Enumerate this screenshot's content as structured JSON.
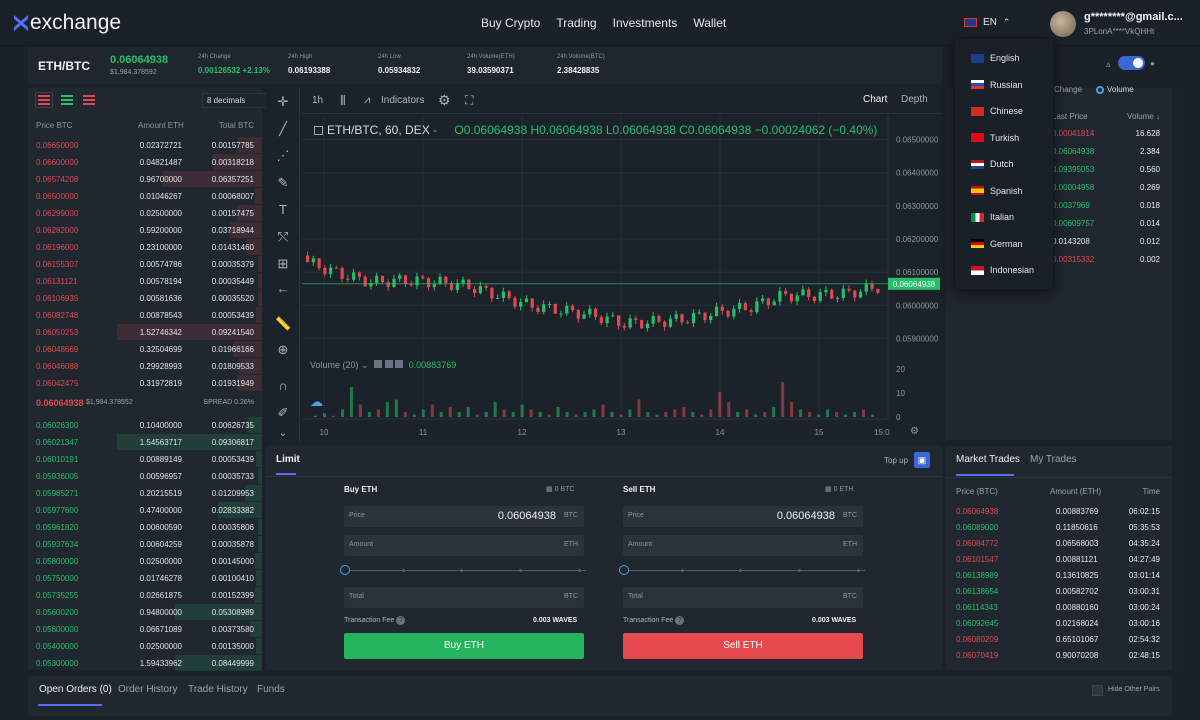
{
  "brand": {
    "name": "exchange"
  },
  "nav": [
    "Buy Crypto",
    "Trading",
    "Investments",
    "Wallet"
  ],
  "language": {
    "current": "EN",
    "options": [
      "English",
      "Russian",
      "Chinese",
      "Turkish",
      "Dutch",
      "Spanish",
      "Italian",
      "German",
      "Indonesian"
    ]
  },
  "account": {
    "email": "g********@gmail.c...",
    "id": "3PLonA****VkQHHt"
  },
  "ticker": {
    "pair": "ETH/BTC",
    "price": "0.06064938",
    "price_usd": "$1,984.378592",
    "stats": [
      {
        "label": "24h Change",
        "value": "0.00126532",
        "extra": "+2.13%"
      },
      {
        "label": "24h High",
        "value": "0.06193388"
      },
      {
        "label": "24h Low",
        "value": "0.05934832"
      },
      {
        "label": "24h Volume(ETH)",
        "value": "39.03590371"
      },
      {
        "label": "24h Volume(BTC)",
        "value": "2.38428835"
      }
    ]
  },
  "orderbook": {
    "decimals": "8 decimals",
    "headers": [
      "Price BTC",
      "Amount ETH",
      "Total BTC"
    ],
    "asks": [
      [
        "0.06650000",
        "0.02372721",
        "0.00157785",
        0.17
      ],
      [
        "0.06600000",
        "0.04821487",
        "0.00318218",
        0.34
      ],
      [
        "0.06574208",
        "0.96700000",
        "0.06357251",
        0.68
      ],
      [
        "0.06500000",
        "0.01046267",
        "0.00068007",
        0.05
      ],
      [
        "0.06299000",
        "0.02500000",
        "0.00157475",
        0.17
      ],
      [
        "0.06282000",
        "0.59200000",
        "0.03718944",
        0.22
      ],
      [
        "0.06196000",
        "0.23100000",
        "0.01431460",
        0.1
      ],
      [
        "0.06155307",
        "0.00574786",
        "0.00035379",
        0.03
      ],
      [
        "0.06131121",
        "0.00578194",
        "0.00035449",
        0.03
      ],
      [
        "0.06106935",
        "0.00581636",
        "0.00035520",
        0.03
      ],
      [
        "0.06082748",
        "0.00878543",
        "0.00053439",
        0.04
      ],
      [
        "0.06050253",
        "1.52746342",
        "0.09241540",
        1.0
      ],
      [
        "0.06048669",
        "0.32504699",
        "0.01966166",
        0.2
      ],
      [
        "0.06046088",
        "0.29928993",
        "0.01809533",
        0.16
      ],
      [
        "0.06042475",
        "0.31972819",
        "0.01931949",
        0.17
      ]
    ],
    "spread_price": "0.06064938",
    "spread_usd": "$1,984.378552",
    "spread_label": "SPREAD 0.26%",
    "bids": [
      [
        "0.06026300",
        "0.10400000",
        "0.00626735",
        0.1
      ],
      [
        "0.06021347",
        "1.54563717",
        "0.09306817",
        1.0
      ],
      [
        "0.06010191",
        "0.00889149",
        "0.00053439",
        0.04
      ],
      [
        "0.05936005",
        "0.00596957",
        "0.00035733",
        0.03
      ],
      [
        "0.05985271",
        "0.20215519",
        "0.01209953",
        0.12
      ],
      [
        "0.05977600",
        "0.47400000",
        "0.02833382",
        0.3
      ],
      [
        "0.05961820",
        "0.00600590",
        "0.00035806",
        0.03
      ],
      [
        "0.05937634",
        "0.00604259",
        "0.00035878",
        0.03
      ],
      [
        "0.05800000",
        "0.02500000",
        "0.00145000",
        0.05
      ],
      [
        "0.05750000",
        "0.01746278",
        "0.00100410",
        0.04
      ],
      [
        "0.05735255",
        "0.02661875",
        "0.00152399",
        0.05
      ],
      [
        "0.05600200",
        "0.94800000",
        "0.05308989",
        0.6
      ],
      [
        "0.05600000",
        "0.06671089",
        "0.00373580",
        0.08
      ],
      [
        "0.05400000",
        "0.02500000",
        "0.00135000",
        0.04
      ],
      [
        "0.05300000",
        "1.59433962",
        "0.08449999",
        0.6
      ]
    ]
  },
  "chart": {
    "interval": "1h",
    "indicators_label": "Indicators",
    "view_tabs": [
      "Chart",
      "Depth"
    ],
    "legend_symbol": "ETH/BTC, 60, DEX",
    "ohlc": "O0.06064938  H0.06064938  L0.06064938  C0.06064938  −0.00024062 (−0.40%)",
    "volume_label": "Volume (20)",
    "volume_value": "0.00883769",
    "price_ticks": [
      "0.06500000",
      "0.06400000",
      "0.06300000",
      "0.06200000",
      "0.06100000",
      "0.06000000",
      "0.05900000"
    ],
    "volume_ticks": [
      "20",
      "10",
      "0"
    ],
    "last_price": "0.06064938",
    "date_ticks": [
      "10",
      "11",
      "12",
      "13",
      "14",
      "15"
    ],
    "date_tail": "15:0",
    "colors": {
      "up": "#26c06a",
      "down": "#e0494f"
    }
  },
  "chart_data": {
    "type": "candlestick",
    "x": [
      "10",
      "11",
      "12",
      "13",
      "14",
      "15"
    ],
    "ylim": [
      0.0585,
      0.0655
    ],
    "candles": [
      [
        0.0615,
        0.06145,
        0.0617,
        0.0613
      ],
      [
        0.06145,
        0.061,
        0.06155,
        0.06095
      ],
      [
        0.061,
        0.0608,
        0.0611,
        0.0607
      ],
      [
        0.0608,
        0.0609,
        0.061,
        0.06075
      ],
      [
        0.0609,
        0.06075,
        0.06095,
        0.0607
      ],
      [
        0.06075,
        0.06065,
        0.0608,
        0.0606
      ],
      [
        0.06065,
        0.0604,
        0.0607,
        0.0603
      ],
      [
        0.0604,
        0.0601,
        0.06045,
        0.06
      ],
      [
        0.0601,
        0.0599,
        0.0602,
        0.05985
      ],
      [
        0.0599,
        0.05975,
        0.06,
        0.0597
      ],
      [
        0.05975,
        0.05955,
        0.05985,
        0.05945
      ],
      [
        0.05955,
        0.0597,
        0.05975,
        0.0595
      ],
      [
        0.0597,
        0.05985,
        0.0599,
        0.0596
      ],
      [
        0.05985,
        0.06,
        0.06005,
        0.0598
      ],
      [
        0.06,
        0.06035,
        0.0604,
        0.05995
      ],
      [
        0.06035,
        0.0606,
        0.06065,
        0.0603
      ],
      [
        0.0606,
        0.0604,
        0.0611,
        0.0603
      ],
      [
        0.0604,
        0.0606,
        0.06085,
        0.06035
      ],
      [
        0.0606,
        0.06065,
        0.0607,
        0.06055
      ]
    ],
    "volume": [
      0.5,
      1.5,
      0.5,
      3,
      12,
      5,
      2,
      3,
      6,
      7,
      2,
      1,
      3,
      5,
      2,
      4,
      2,
      4,
      1,
      2,
      6,
      3,
      2,
      5,
      3,
      2,
      1,
      4,
      2,
      1,
      2,
      3,
      5,
      2,
      1,
      3,
      7,
      2,
      1,
      2,
      3,
      4,
      2,
      1,
      3,
      10,
      6,
      2,
      3,
      1,
      2,
      4,
      14,
      6,
      3,
      2,
      1,
      3,
      2,
      1,
      2,
      3,
      1
    ],
    "volume_colors": [
      "u",
      "u",
      "d",
      "u",
      "u",
      "d",
      "u",
      "d",
      "u",
      "u",
      "d",
      "u",
      "u",
      "d",
      "u",
      "d",
      "u",
      "u",
      "d",
      "u",
      "u",
      "d",
      "u",
      "u",
      "d",
      "u",
      "d",
      "u",
      "u",
      "d",
      "u",
      "u",
      "d",
      "u",
      "d",
      "u",
      "d",
      "u",
      "u",
      "d",
      "d",
      "d",
      "u",
      "d",
      "d",
      "d",
      "d",
      "u",
      "d",
      "u",
      "d",
      "u",
      "d",
      "d",
      "u",
      "d",
      "u",
      "u",
      "d",
      "u",
      "u",
      "d",
      "u"
    ],
    "last_price": 0.06064938
  },
  "order_form": {
    "tab": "Limit",
    "topup_label": "Top up",
    "buy": {
      "title": "Buy ETH",
      "balance": "0 BTC",
      "price": "0.06064938",
      "price_unit": "BTC",
      "amount_unit": "ETH",
      "total_unit": "BTC",
      "fee": "0.003 WAVES",
      "button": "Buy ETH"
    },
    "sell": {
      "title": "Sell ETH",
      "balance": "0 ETH",
      "price": "0.06064938",
      "price_unit": "BTC",
      "amount_unit": "ETH",
      "total_unit": "BTC",
      "fee": "0.003 WAVES",
      "button": "Sell ETH"
    },
    "labels": {
      "price": "Price",
      "amount": "Amount",
      "total": "Total",
      "fee": "Transaction Fee"
    }
  },
  "markets": {
    "radio_change": "Change",
    "radio_volume": "Volume",
    "headers": [
      "Last Price",
      "Volume"
    ],
    "rows": [
      [
        "0.00041814",
        "16.628",
        "#e0494f"
      ],
      [
        "0.06064938",
        "2.384",
        "#26c06a"
      ],
      [
        "0.09395053",
        "0.560",
        "#26c06a"
      ],
      [
        "0.00004958",
        "0.269",
        "#26c06a"
      ],
      [
        "0.0037969",
        "0.018",
        "#26c06a"
      ],
      [
        "0.00609757",
        "0.014",
        "#26c06a"
      ],
      [
        "0.0143208",
        "0.012",
        "#e6e9ec"
      ],
      [
        "0.00315332",
        "0.002",
        "#e0494f"
      ]
    ]
  },
  "market_trades": {
    "tabs": [
      "Market Trades",
      "My Trades"
    ],
    "headers": [
      "Price (BTC)",
      "Amount (ETH)",
      "Time"
    ],
    "rows": [
      [
        "0.06064938",
        "0.00883769",
        "06:02:15",
        "d"
      ],
      [
        "0.06089000",
        "0.11850616",
        "05:35:53",
        "u"
      ],
      [
        "0.06084772",
        "0.06568003",
        "04:35:24",
        "d"
      ],
      [
        "0.06101547",
        "0.00881121",
        "04:27:49",
        "d"
      ],
      [
        "0.06138989",
        "0.13610825",
        "03:01:14",
        "u"
      ],
      [
        "0.06138654",
        "0.00582702",
        "03:00:31",
        "u"
      ],
      [
        "0.06114343",
        "0.00880160",
        "03:00:24",
        "u"
      ],
      [
        "0.06092645",
        "0.02168024",
        "03:00:16",
        "u"
      ],
      [
        "0.06080209",
        "0.65101067",
        "02:54:32",
        "d"
      ],
      [
        "0.06070419",
        "0.90070208",
        "02:48:15",
        "d"
      ]
    ]
  },
  "bottom_tabs": [
    "Open Orders (0)",
    "Order History",
    "Trade History",
    "Funds"
  ],
  "hide_pairs": "Hide Other Pairs"
}
